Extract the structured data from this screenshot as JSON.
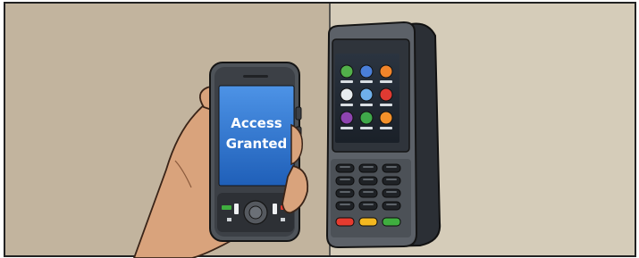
{
  "phone": {
    "screen_line1": "Access",
    "screen_line2": "Granted"
  },
  "terminal": {
    "app_icons": [
      {
        "name": "app-icon-green",
        "color": "#52b04a"
      },
      {
        "name": "app-icon-blue",
        "color": "#4a7fd8"
      },
      {
        "name": "app-icon-orange",
        "color": "#f0842a"
      },
      {
        "name": "app-icon-white",
        "color": "#e8ecef"
      },
      {
        "name": "app-icon-lightblue",
        "color": "#6fb0ea"
      },
      {
        "name": "app-icon-red",
        "color": "#e03a32"
      },
      {
        "name": "app-icon-purple",
        "color": "#8e44b0"
      },
      {
        "name": "app-icon-green-2",
        "color": "#3fa84a"
      },
      {
        "name": "app-icon-orange-2",
        "color": "#f3902a"
      }
    ],
    "function_keys": [
      "#e53b2f",
      "#f3b820",
      "#3fae3f"
    ]
  },
  "colors": {
    "wall_left": "#c2b49e",
    "wall_right": "#d5ccb9",
    "skin": "#d9a37c",
    "phone_screen": "#2a6fc8"
  }
}
